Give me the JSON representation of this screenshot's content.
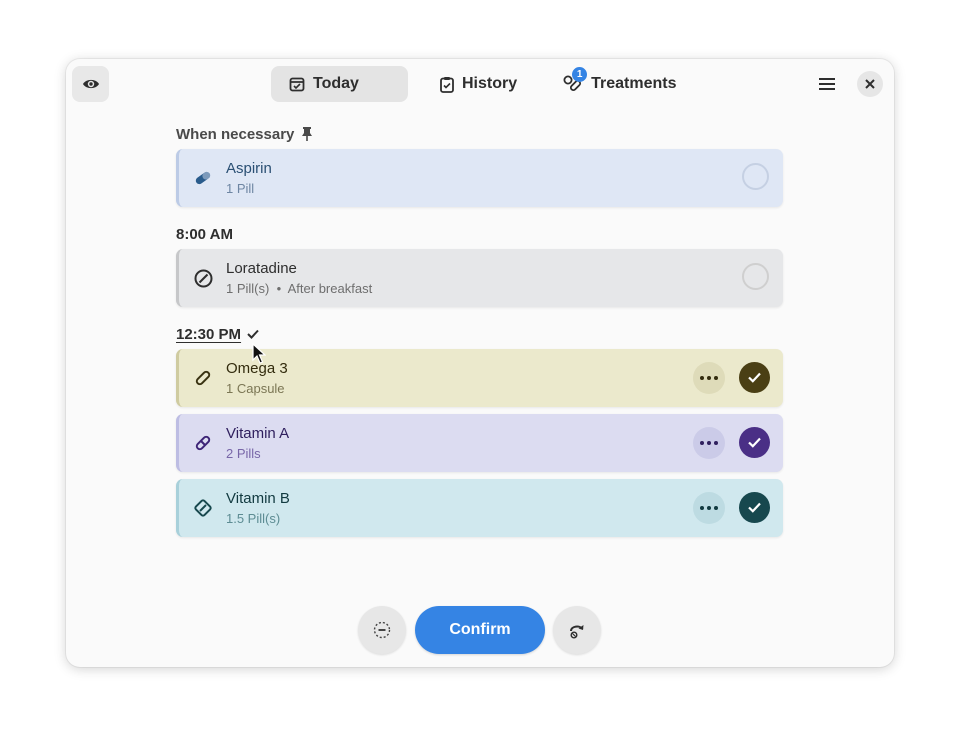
{
  "header": {
    "tabs": [
      {
        "label": "Today",
        "icon": "calendar-icon",
        "active": true
      },
      {
        "label": "History",
        "icon": "clipboard-icon",
        "active": false
      },
      {
        "label": "Treatments",
        "icon": "pills-icon",
        "active": false,
        "badge": "1"
      }
    ]
  },
  "sections": {
    "when_necessary": {
      "title": "When necessary",
      "items": [
        {
          "name": "Aspirin",
          "dose": "1 Pill",
          "color": "#dfe7f5",
          "accent": "#2a5c8c"
        }
      ]
    },
    "morning": {
      "title": "8:00 AM",
      "items": [
        {
          "name": "Loratadine",
          "dose": "1 Pill(s)",
          "note": "After breakfast",
          "color": "#e6e7e9",
          "accent": "#2e2e2e"
        }
      ]
    },
    "noon": {
      "title": "12:30 PM",
      "items": [
        {
          "name": "Omega 3",
          "dose": "1 Capsule",
          "color": "#ebe9cc",
          "accent": "#4a3f14"
        },
        {
          "name": "Vitamin A",
          "dose": "2 Pills",
          "color": "#dcdcf1",
          "accent": "#4a2f86"
        },
        {
          "name": "Vitamin B",
          "dose": "1.5 Pill(s)",
          "color": "#d0e8ee",
          "accent": "#17484e"
        }
      ]
    }
  },
  "footer": {
    "confirm_label": "Confirm"
  }
}
